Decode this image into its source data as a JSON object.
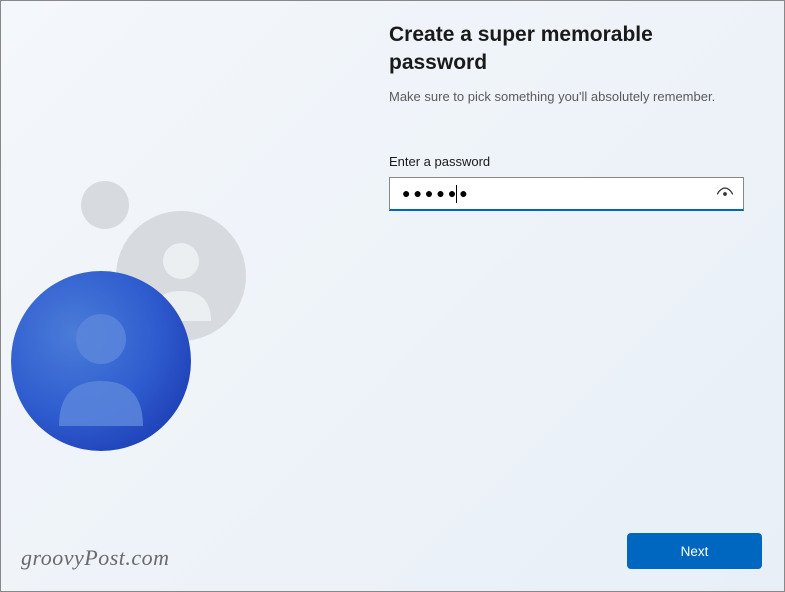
{
  "title": "Create a super memorable password",
  "subtitle": "Make sure to pick something you'll absolutely remember.",
  "password": {
    "label": "Enter a password",
    "value": "●●●●●●"
  },
  "actions": {
    "next": "Next"
  },
  "watermark": "groovyPost.com"
}
